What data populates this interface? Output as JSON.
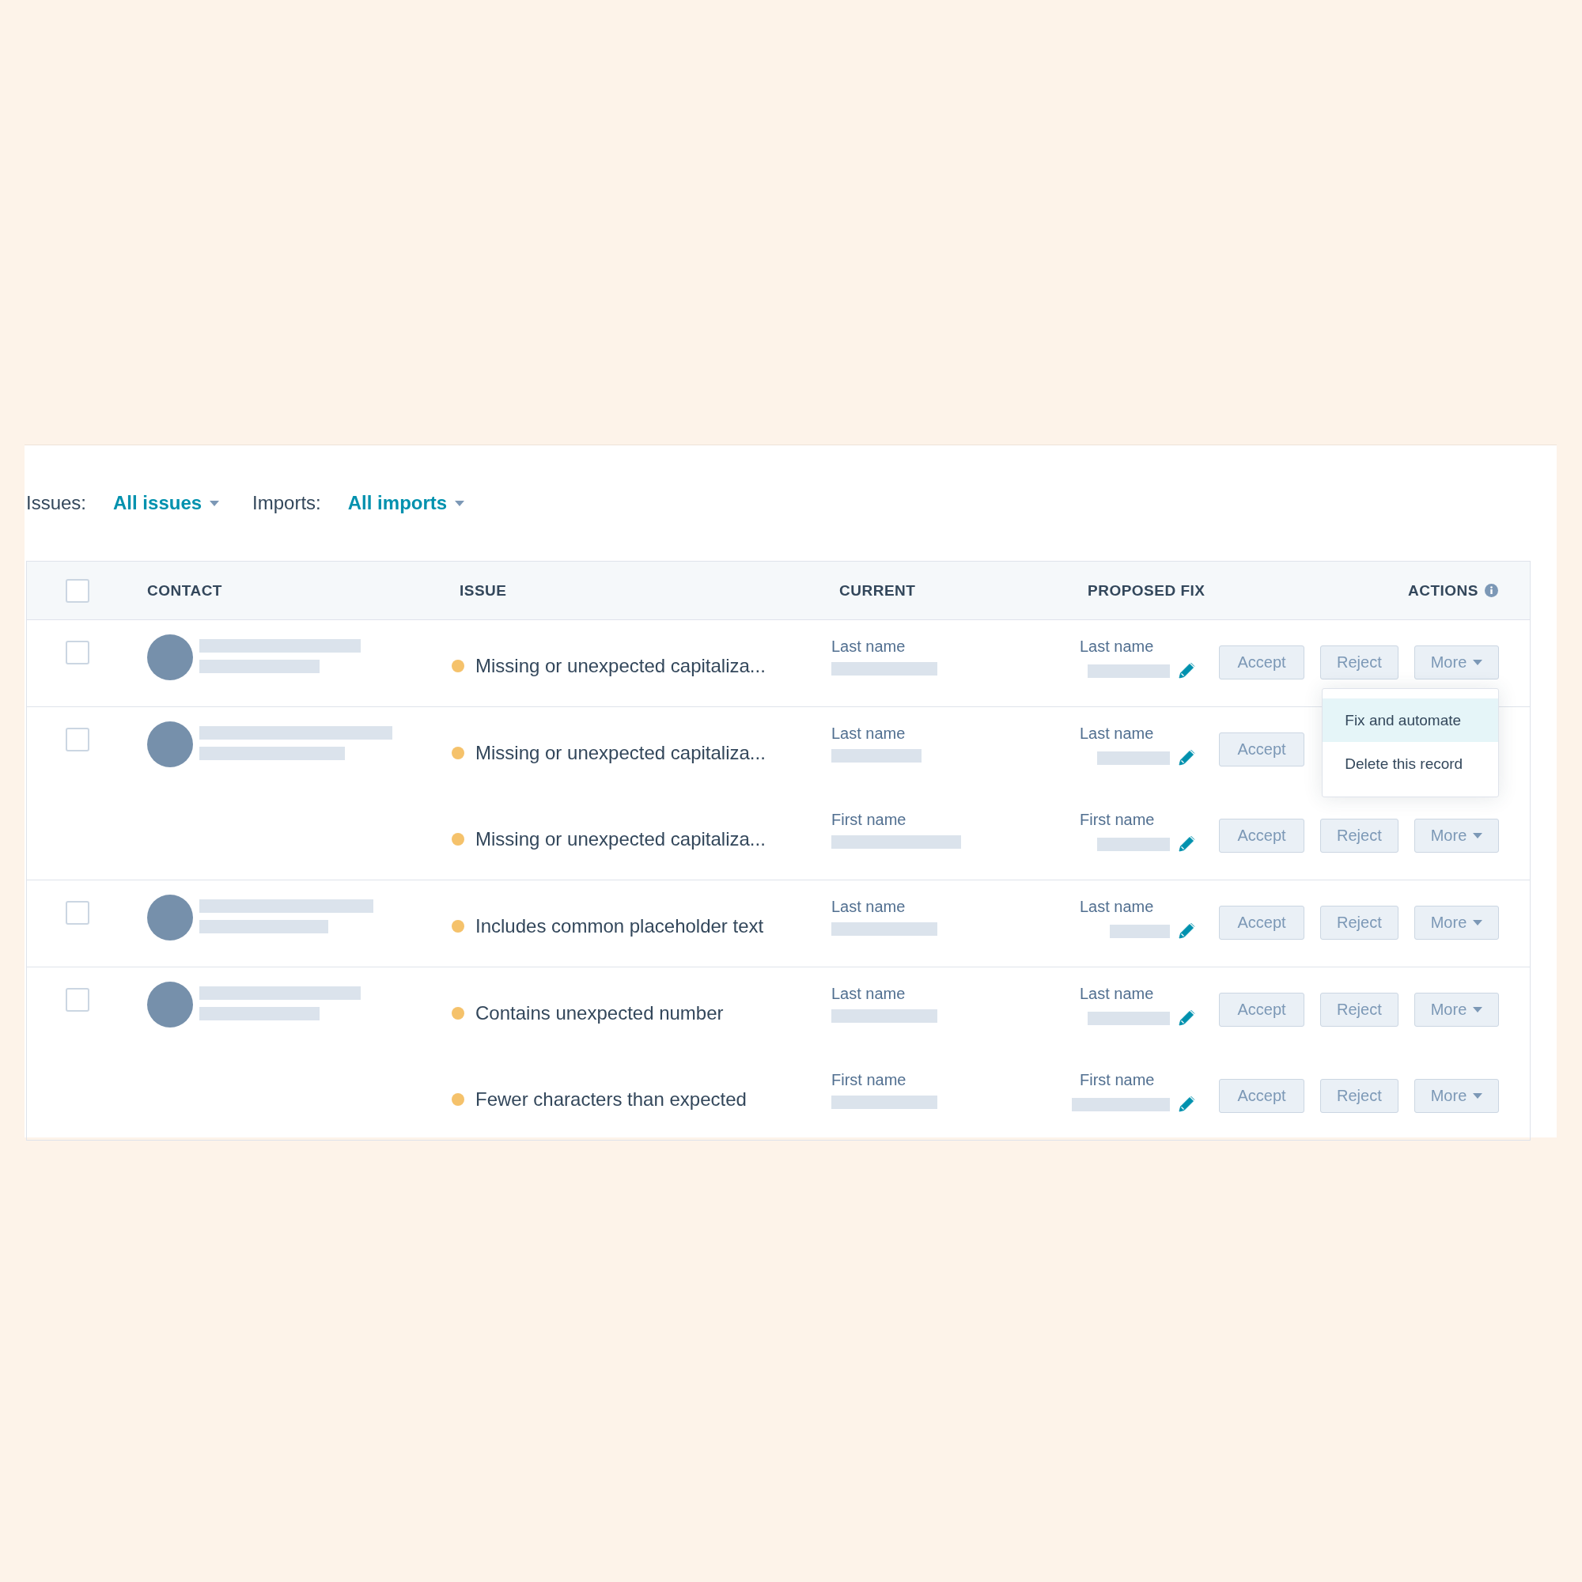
{
  "filters": [
    {
      "label": "Issues:",
      "value": "All issues"
    },
    {
      "label": "Imports:",
      "value": "All imports"
    }
  ],
  "table": {
    "select_all_checked": false,
    "columns": [
      {
        "label": "CONTACT"
      },
      {
        "label": "ISSUE"
      },
      {
        "label": "CURRENT"
      },
      {
        "label": "PROPOSED FIX"
      },
      {
        "label": "ACTIONS",
        "info": true
      }
    ],
    "records": [
      {
        "checked": false,
        "issues": [
          {
            "issue": "Missing or unexpected capitaliza...",
            "current": "Last name",
            "proposed": "Last name",
            "buttons": [
              {
                "label": "Accept",
                "kind": "plain"
              },
              {
                "label": "Reject",
                "kind": "plain"
              },
              {
                "label": "More",
                "kind": "menu",
                "menu": [
                  {
                    "label": "Fix and automate",
                    "selected": true
                  },
                  {
                    "label": "Delete this record",
                    "selected": false
                  }
                ]
              }
            ]
          }
        ]
      },
      {
        "checked": false,
        "issues": [
          {
            "issue": "Missing or unexpected capitaliza...",
            "current": "Last name",
            "proposed": "Last name",
            "buttons": [
              {
                "label": "Accept",
                "kind": "plain"
              }
            ]
          },
          {
            "issue": "Missing or unexpected capitaliza...",
            "current": "First name",
            "proposed": "First name",
            "buttons": [
              {
                "label": "Accept",
                "kind": "plain"
              },
              {
                "label": "Reject",
                "kind": "plain"
              },
              {
                "label": "More",
                "kind": "menu"
              }
            ]
          }
        ]
      },
      {
        "checked": false,
        "issues": [
          {
            "issue": "Includes common placeholder text",
            "current": "Last name",
            "proposed": "Last name",
            "buttons": [
              {
                "label": "Accept",
                "kind": "plain"
              },
              {
                "label": "Reject",
                "kind": "plain"
              },
              {
                "label": "More",
                "kind": "menu"
              }
            ]
          }
        ]
      },
      {
        "checked": false,
        "issues": [
          {
            "issue": "Contains unexpected number",
            "current": "Last name",
            "proposed": "Last name",
            "buttons": [
              {
                "label": "Accept",
                "kind": "plain"
              },
              {
                "label": "Reject",
                "kind": "plain"
              },
              {
                "label": "More",
                "kind": "menu"
              }
            ]
          },
          {
            "issue": "Fewer characters than expected",
            "current": "First name",
            "proposed": "First name",
            "buttons": [
              {
                "label": "Accept",
                "kind": "plain"
              },
              {
                "label": "Reject",
                "kind": "plain"
              },
              {
                "label": "More",
                "kind": "menu"
              }
            ]
          }
        ]
      }
    ]
  }
}
